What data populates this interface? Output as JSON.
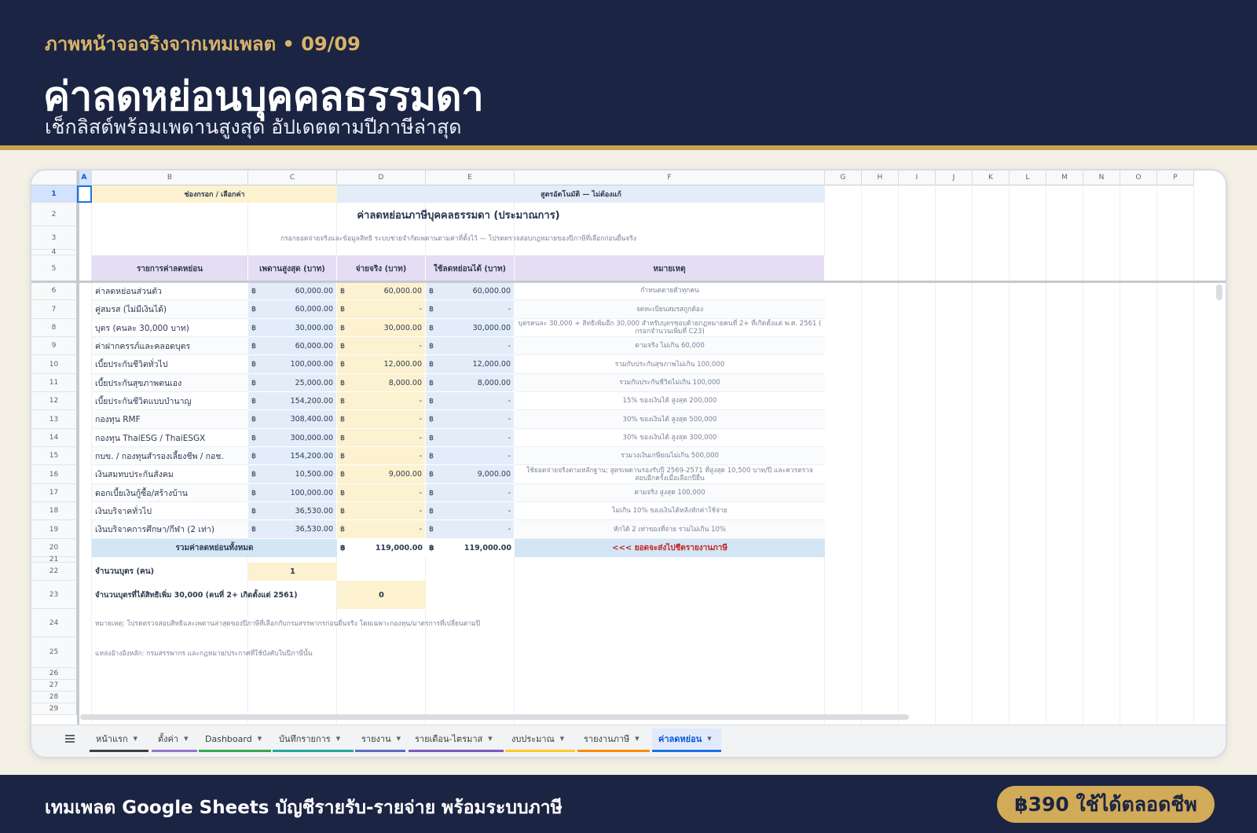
{
  "header": {
    "kicker": "ภาพหน้าจอจริงจากเทมเพลต • 09/09",
    "title": "ค่าลดหย่อนบุคคลธรรมดา",
    "subtitle": "เช็กลิสต์พร้อมเพดานสูงสุด อัปเดตตามปีภาษีล่าสุด"
  },
  "footer": {
    "text": "เทมเพลต Google Sheets บัญชีรายรับ-รายจ่าย พร้อมระบบภาษี",
    "price": "฿390 ใช้ได้ตลอดชีพ"
  },
  "sheet": {
    "columns": [
      "A",
      "B",
      "C",
      "D",
      "E",
      "F",
      "G",
      "H",
      "I",
      "J",
      "K",
      "L",
      "M",
      "N",
      "O",
      "P"
    ],
    "legend_input": "ช่องกรอก / เลือกค่า",
    "legend_formula": "สูตรอัตโนมัติ — ไม่ต้องแก้",
    "title": "ค่าลดหย่อนภาษีบุคคลธรรมดา (ประมาณการ)",
    "subtitle": "กรอกยอดจ่ายจริงและข้อมูลสิทธิ ระบบช่วยจำกัดเพดานตามค่าที่ตั้งไว้ — โปรดตรวจสอบกฎหมายของปีภาษีที่เลือกก่อนยื่นจริง",
    "headers": [
      "รายการค่าลดหย่อน",
      "เพดานสูงสุด (บาท)",
      "จ่ายจริง (บาท)",
      "ใช้ลดหย่อนได้ (บาท)",
      "หมายเหตุ"
    ],
    "currency": "฿",
    "rows": [
      {
        "item": "ค่าลดหย่อนส่วนตัว",
        "cap": "60,000.00",
        "paid": "60,000.00",
        "usable": "60,000.00",
        "note": "กำหนดตายตัวทุกคน"
      },
      {
        "item": "คู่สมรส (ไม่มีเงินได้)",
        "cap": "60,000.00",
        "paid": "-",
        "usable": "-",
        "note": "จดทะเบียนสมรสถูกต้อง"
      },
      {
        "item": "บุตร (คนละ 30,000 บาท)",
        "cap": "30,000.00",
        "paid": "30,000.00",
        "usable": "30,000.00",
        "note": "บุตรคนละ 30,000 + สิทธิเพิ่มอีก 30,000 สำหรับบุตรชอบด้วยกฎหมายคนที่ 2+ ที่เกิดตั้งแต่ พ.ศ. 2561 (",
        "note2": "กรอกจำนวนเพิ่มที่ C23)"
      },
      {
        "item": "ค่าฝากครรภ์และคลอดบุตร",
        "cap": "60,000.00",
        "paid": "-",
        "usable": "-",
        "note": "ตามจริง ไม่เกิน 60,000"
      },
      {
        "item": "เบี้ยประกันชีวิตทั่วไป",
        "cap": "100,000.00",
        "paid": "12,000.00",
        "usable": "12,000.00",
        "note": "รวมกับประกันสุขภาพไม่เกิน 100,000"
      },
      {
        "item": "เบี้ยประกันสุขภาพตนเอง",
        "cap": "25,000.00",
        "paid": "8,000.00",
        "usable": "8,000.00",
        "note": "รวมกับประกันชีวิตไม่เกิน 100,000"
      },
      {
        "item": "เบี้ยประกันชีวิตแบบบำนาญ",
        "cap": "154,200.00",
        "paid": "-",
        "usable": "-",
        "note": "15% ของเงินได้ สูงสุด 200,000"
      },
      {
        "item": "กองทุน RMF",
        "cap": "308,400.00",
        "paid": "-",
        "usable": "-",
        "note": "30% ของเงินได้ สูงสุด 500,000"
      },
      {
        "item": "กองทุน ThaiESG / ThaiESGX",
        "cap": "300,000.00",
        "paid": "-",
        "usable": "-",
        "note": "30% ของเงินได้ สูงสุด 300,000"
      },
      {
        "item": "กบข. / กองทุนสำรองเลี้ยงชีพ / กอช.",
        "cap": "154,200.00",
        "paid": "-",
        "usable": "-",
        "note": "รวมวงเงินเกษียณไม่เกิน 500,000"
      },
      {
        "item": "เงินสมทบประกันสังคม",
        "cap": "10,500.00",
        "paid": "9,000.00",
        "usable": "9,000.00",
        "note": "ใช้ยอดจ่ายจริงตามหลักฐาน; สูตรเพดานรองรับปี 2569-2571 ที่สูงสุด 10,500 บาท/ปี และควรตรวจ",
        "note2": "สอบอีกครั้งเมื่อเลือกปียื่น"
      },
      {
        "item": "ดอกเบี้ยเงินกู้ซื้อ/สร้างบ้าน",
        "cap": "100,000.00",
        "paid": "-",
        "usable": "-",
        "note": "ตามจริง สูงสุด 100,000"
      },
      {
        "item": "เงินบริจาคทั่วไป",
        "cap": "36,530.00",
        "paid": "-",
        "usable": "-",
        "note": "ไม่เกิน 10% ของเงินได้หลังหักค่าใช้จ่าย"
      },
      {
        "item": "เงินบริจาคการศึกษา/กีฬา (2 เท่า)",
        "cap": "36,530.00",
        "paid": "-",
        "usable": "-",
        "note": "หักได้ 2 เท่าของที่จ่าย รวมไม่เกิน 10%"
      }
    ],
    "total": {
      "label": "รวมค่าลดหย่อนทั้งหมด",
      "paid": "119,000.00",
      "usable": "119,000.00",
      "note": "<<< ยอดจะส่งไปชีตรายงานภาษี"
    },
    "children_label": "จำนวนบุตร (คน)",
    "children_value": "1",
    "extra_label": "จำนวนบุตรที่ได้สิทธิเพิ่ม 30,000 (คนที่ 2+ เกิดตั้งแต่ 2561)",
    "extra_value": "0",
    "remark": "หมายเหตุ: โปรดตรวจสอบสิทธิและเพดานล่าสุดของปีภาษีที่เลือกกับกรมสรรพากรก่อนยื่นจริง โดยเฉพาะกองทุน/มาตรการที่เปลี่ยนตามปี",
    "source": "แหล่งอ้างอิงหลัก: กรมสรรพากร และกฎหมาย/ประกาศที่ใช้บังคับในปีภาษีนั้น"
  },
  "tabs": [
    {
      "label": "หน้าแรก",
      "color": "#3c4043"
    },
    {
      "label": "ตั้งค่า",
      "color": "#9575cd"
    },
    {
      "label": "Dashboard",
      "color": "#34a853"
    },
    {
      "label": "บันทึกรายการ",
      "color": "#26a69a"
    },
    {
      "label": "รายงาน",
      "color": "#5c6bc0"
    },
    {
      "label": "รายเดือน-ไตรมาส",
      "color": "#7e57c2"
    },
    {
      "label": "งบประมาณ",
      "color": "#ffca28"
    },
    {
      "label": "รายงานภาษี",
      "color": "#fb8c00"
    },
    {
      "label": "ค่าลดหย่อน",
      "color": "#1a73e8"
    }
  ],
  "colors": {
    "input": "#fdf2cf",
    "formula": "#e3edf9",
    "header": "#e4ddf3",
    "total_label": "#d2e6f5",
    "accent": "#c9a24f",
    "navy": "#1b2442"
  }
}
